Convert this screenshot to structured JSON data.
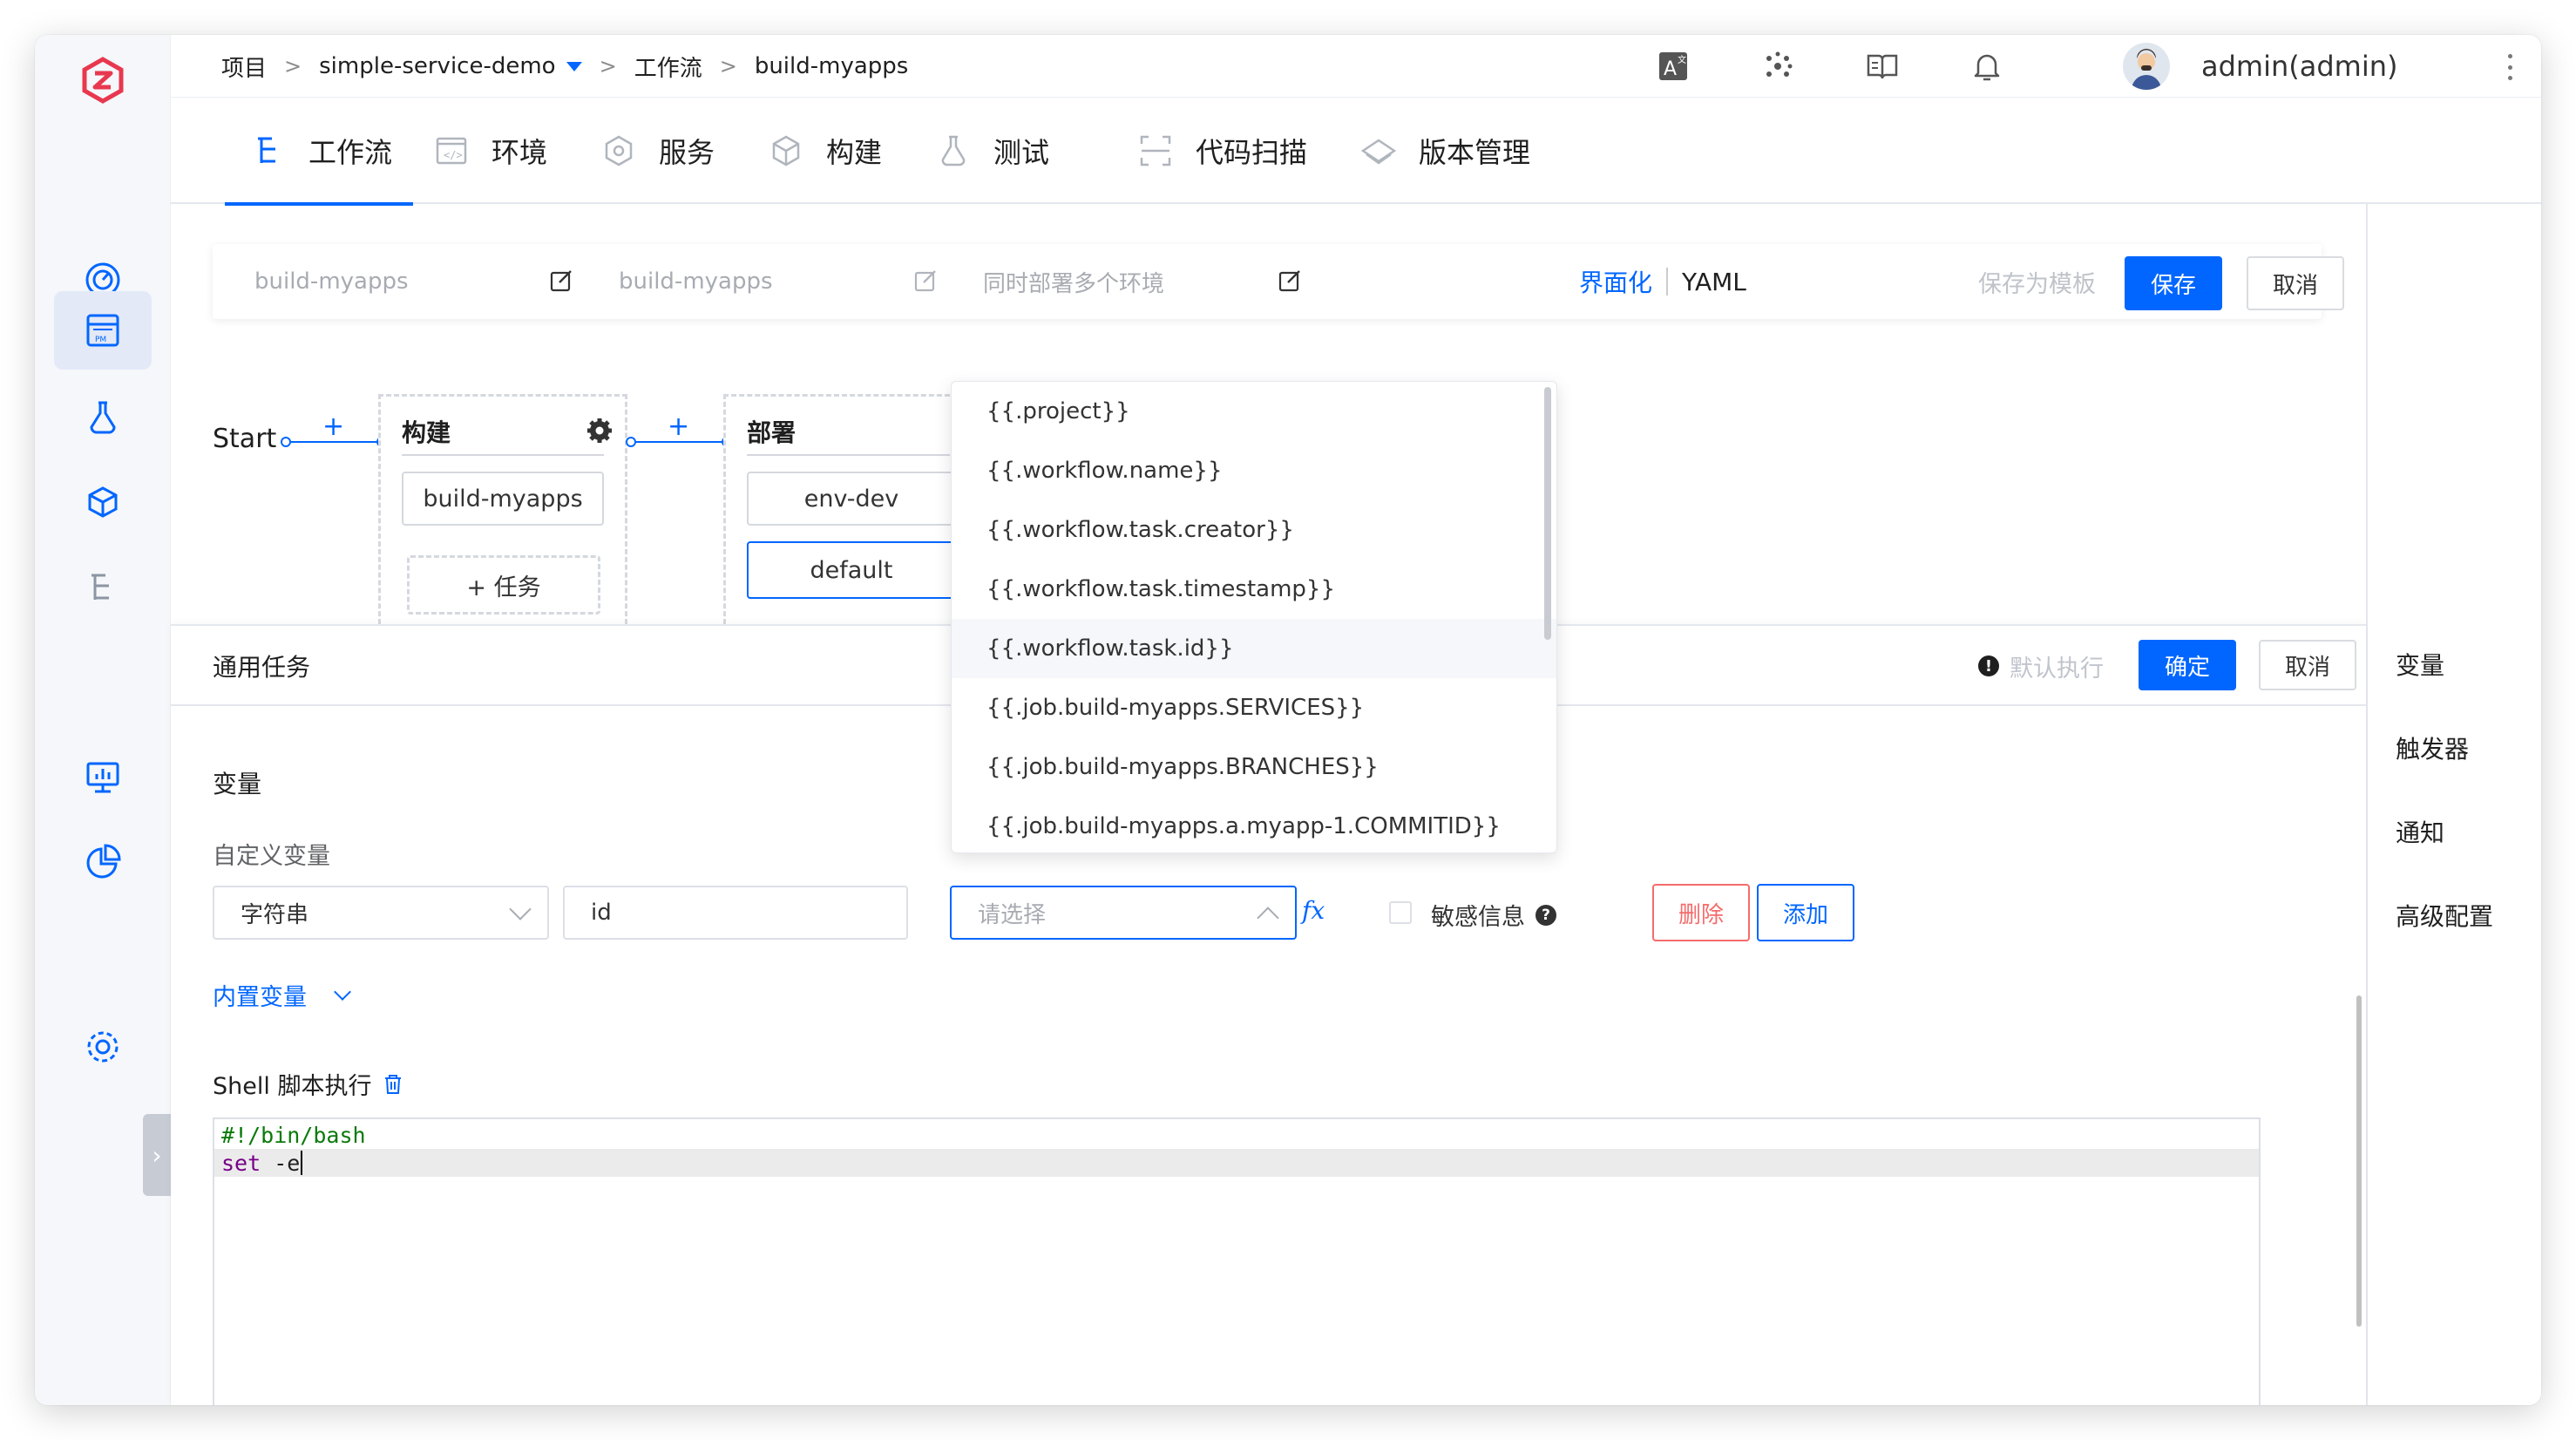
{
  "breadcrumb": {
    "project_label": "项目",
    "project_name": "simple-service-demo",
    "workflow_label": "工作流",
    "workflow_name": "build-myapps"
  },
  "user": {
    "name": "admin(admin)"
  },
  "tabs": [
    {
      "label": "工作流",
      "icon": "workflow-icon",
      "active": true
    },
    {
      "label": "环境",
      "icon": "environment-icon"
    },
    {
      "label": "服务",
      "icon": "service-icon"
    },
    {
      "label": "构建",
      "icon": "build-icon"
    },
    {
      "label": "测试",
      "icon": "test-icon"
    },
    {
      "label": "代码扫描",
      "icon": "scan-icon"
    },
    {
      "label": "版本管理",
      "icon": "version-icon"
    }
  ],
  "toolbar": {
    "workflow_name": "build-myapps",
    "display_name": "build-myapps",
    "description": "同时部署多个环境",
    "mode_ui": "界面化",
    "mode_yaml": "YAML",
    "save_template": "保存为模板",
    "save": "保存",
    "cancel": "取消"
  },
  "pipeline": {
    "start": "Start",
    "plus": "+",
    "stage1": {
      "title": "构建",
      "job": "build-myapps",
      "add_task": "+ 任务"
    },
    "stage2": {
      "title": "部署",
      "job1": "env-dev",
      "job2": "default"
    }
  },
  "drawer": {
    "title": "通用任务",
    "default_exec": "默认执行",
    "confirm": "确定",
    "cancel": "取消",
    "variables_title": "变量",
    "custom_vars": "自定义变量",
    "var_type": "字符串",
    "var_key": "id",
    "var_value_placeholder": "请选择",
    "fx": "fx",
    "sensitive": "敏感信息",
    "delete": "删除",
    "add": "添加",
    "builtin_vars": "内置变量",
    "shell_title": "Shell 脚本执行",
    "code": {
      "line1": "#!/bin/bash",
      "line2_kw": "set",
      "line2_rest": " -e"
    }
  },
  "dropdown": {
    "options": [
      "{{.project}}",
      "{{.workflow.name}}",
      "{{.workflow.task.creator}}",
      "{{.workflow.task.timestamp}}",
      "{{.workflow.task.id}}",
      "{{.job.build-myapps.SERVICES}}",
      "{{.job.build-myapps.BRANCHES}}",
      "{{.job.build-myapps.a.myapp-1.COMMITID}}"
    ],
    "hovered_index": 4
  },
  "right_panel": {
    "items": [
      "变量",
      "触发器",
      "通知",
      "高级配置"
    ]
  },
  "colors": {
    "accent": "#0066ff",
    "danger": "#f56c6c",
    "logo": "#e8384f"
  }
}
